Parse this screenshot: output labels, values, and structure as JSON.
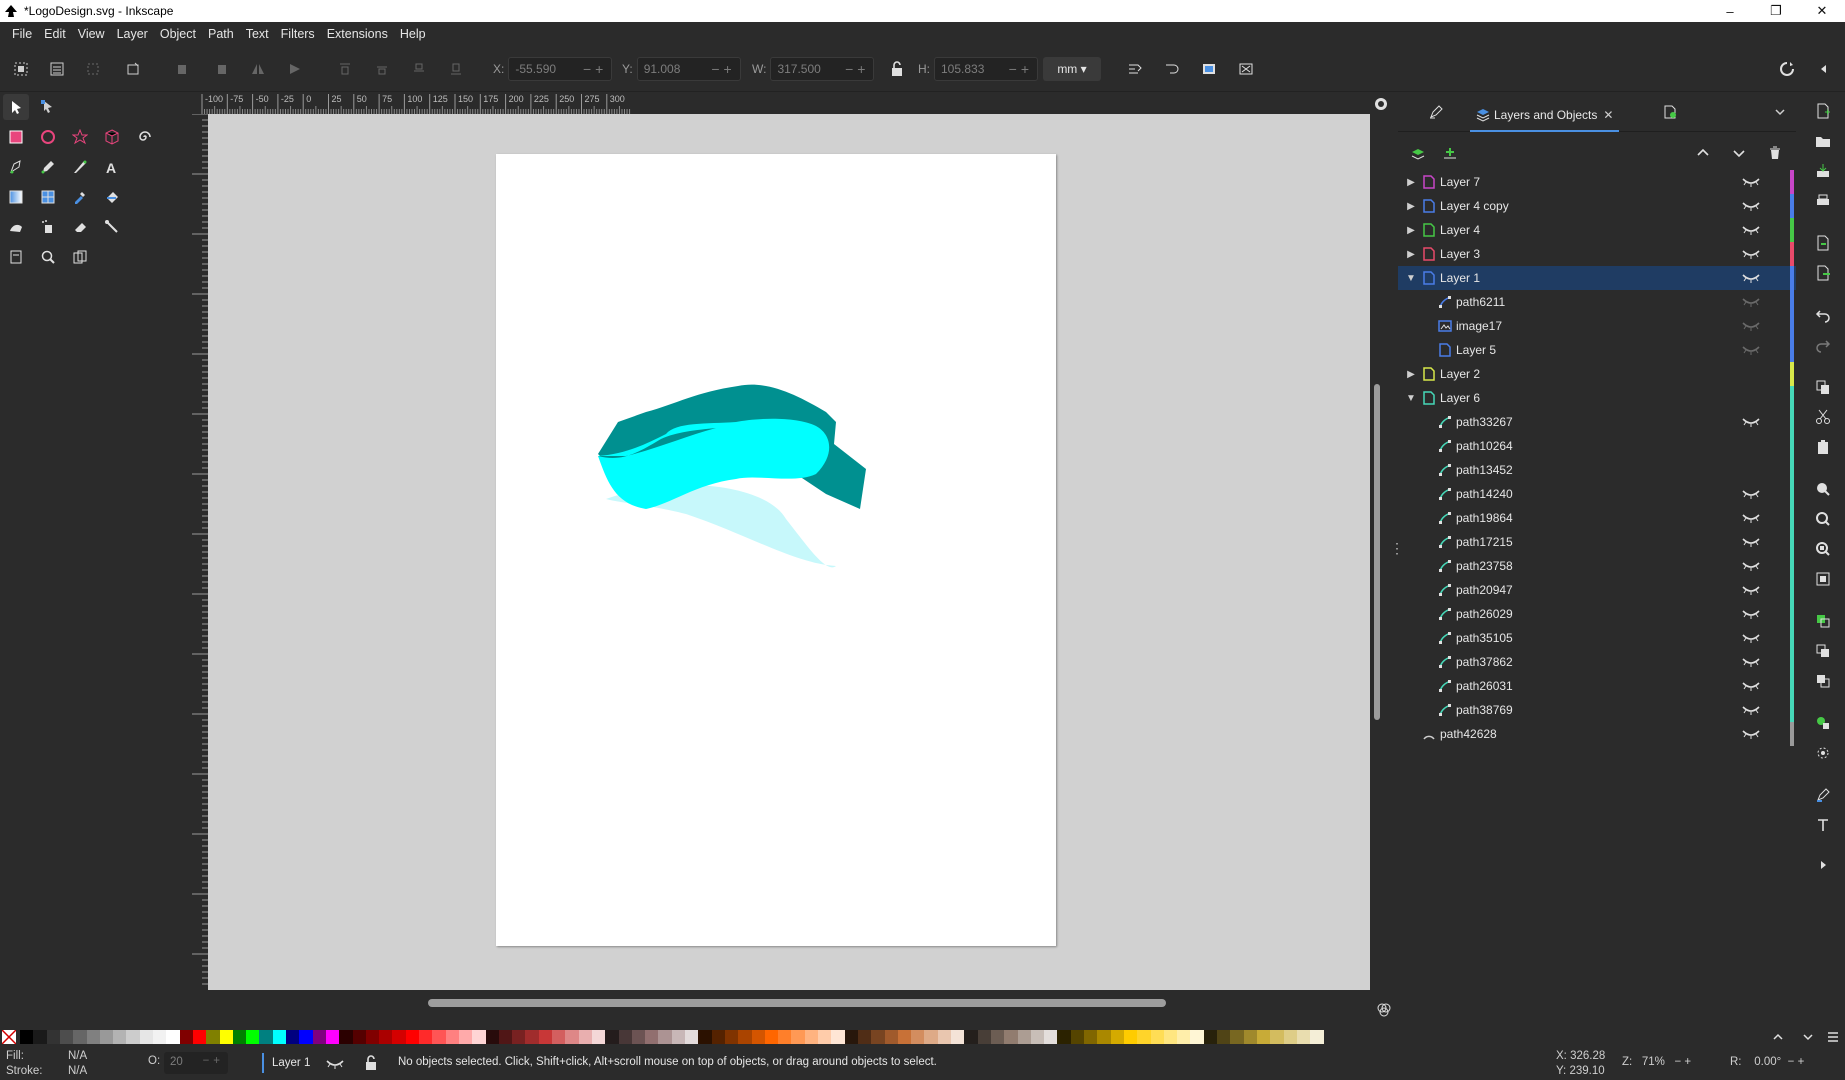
{
  "window": {
    "title": "*LogoDesign.svg - Inkscape",
    "controls": [
      "–",
      "❐",
      "✕"
    ]
  },
  "menu": [
    "File",
    "Edit",
    "View",
    "Layer",
    "Object",
    "Path",
    "Text",
    "Filters",
    "Extensions",
    "Help"
  ],
  "toolbar": {
    "x_label": "X:",
    "x_value": "-55.590",
    "y_label": "Y:",
    "y_value": "91.008",
    "w_label": "W:",
    "w_value": "317.500",
    "h_label": "H:",
    "h_value": "105.833",
    "unit": "mm"
  },
  "ruler_ticks": [
    "-100",
    "-75",
    "-50",
    "-25",
    "0",
    "25",
    "50",
    "75",
    "100",
    "125",
    "150",
    "175",
    "200",
    "225",
    "250",
    "275",
    "300"
  ],
  "dock": {
    "active_tab": "Layers and Objects",
    "layers": [
      {
        "label": "Layer 7",
        "kind": "layer",
        "level": 0,
        "expanded": false,
        "color": "#c846c8",
        "eye": "visible"
      },
      {
        "label": "Layer 4 copy",
        "kind": "layer",
        "level": 0,
        "expanded": false,
        "color": "#4a7de8",
        "eye": "visible"
      },
      {
        "label": "Layer 4",
        "kind": "layer",
        "level": 0,
        "expanded": false,
        "color": "#46c846",
        "eye": "visible"
      },
      {
        "label": "Layer 3",
        "kind": "layer",
        "level": 0,
        "expanded": false,
        "color": "#e84a6a",
        "eye": "visible"
      },
      {
        "label": "Layer 1",
        "kind": "layer",
        "level": 0,
        "expanded": true,
        "selected": true,
        "color": "#4a7de8",
        "eye": "visible"
      },
      {
        "label": "path6211",
        "kind": "path",
        "level": 1,
        "color": "#4a7de8",
        "eye": "faded"
      },
      {
        "label": "image17",
        "kind": "image",
        "level": 1,
        "color": "#4a7de8",
        "eye": "faded"
      },
      {
        "label": "Layer 5",
        "kind": "layer",
        "level": 1,
        "color": "#4a7de8",
        "eye": "faded"
      },
      {
        "label": "Layer 2",
        "kind": "layer",
        "level": 0,
        "expanded": false,
        "color": "#d8e84a",
        "eye": "none"
      },
      {
        "label": "Layer 6",
        "kind": "layer",
        "level": 0,
        "expanded": true,
        "color": "#46d8b8",
        "eye": "none"
      },
      {
        "label": "path33267",
        "kind": "path",
        "level": 1,
        "color": "#46d8b8",
        "eye": "visible"
      },
      {
        "label": "path10264",
        "kind": "path",
        "level": 1,
        "color": "#46d8b8",
        "eye": "none"
      },
      {
        "label": "path13452",
        "kind": "path",
        "level": 1,
        "color": "#46d8b8",
        "eye": "none"
      },
      {
        "label": "path14240",
        "kind": "path",
        "level": 1,
        "color": "#46d8b8",
        "eye": "visible"
      },
      {
        "label": "path19864",
        "kind": "path",
        "level": 1,
        "color": "#46d8b8",
        "eye": "visible"
      },
      {
        "label": "path17215",
        "kind": "path",
        "level": 1,
        "color": "#46d8b8",
        "eye": "visible"
      },
      {
        "label": "path23758",
        "kind": "path",
        "level": 1,
        "color": "#46d8b8",
        "eye": "visible"
      },
      {
        "label": "path20947",
        "kind": "path",
        "level": 1,
        "color": "#46d8b8",
        "eye": "visible"
      },
      {
        "label": "path26029",
        "kind": "path",
        "level": 1,
        "color": "#46d8b8",
        "eye": "visible"
      },
      {
        "label": "path35105",
        "kind": "path",
        "level": 1,
        "color": "#46d8b8",
        "eye": "visible"
      },
      {
        "label": "path37862",
        "kind": "path",
        "level": 1,
        "color": "#46d8b8",
        "eye": "visible"
      },
      {
        "label": "path26031",
        "kind": "path",
        "level": 1,
        "color": "#46d8b8",
        "eye": "visible"
      },
      {
        "label": "path38769",
        "kind": "path",
        "level": 1,
        "color": "#46d8b8",
        "eye": "visible"
      },
      {
        "label": "path42628",
        "kind": "arc",
        "level": 0,
        "color": "#9a9a9a",
        "eye": "visible"
      }
    ]
  },
  "status": {
    "fill_label": "Fill:",
    "fill_value": "N/A",
    "stroke_label": "Stroke:",
    "stroke_value": "N/A",
    "opacity_label": "O:",
    "opacity_value": "20",
    "layer": "Layer 1",
    "message": "No objects selected. Click, Shift+click, Alt+scroll mouse on top of objects, or drag around objects to select.",
    "x_label": "X:",
    "x_value": "326.28",
    "y_label": "Y:",
    "y_value": "239.10",
    "zoom_label": "Z:",
    "zoom_value": "71%",
    "rotation_label": "R:",
    "rotation_value": "0.00°"
  },
  "palette": [
    "#000000",
    "#1a1a1a",
    "#333333",
    "#4d4d4d",
    "#666666",
    "#808080",
    "#999999",
    "#b3b3b3",
    "#cccccc",
    "#e6e6e6",
    "#f2f2f2",
    "#ffffff",
    "#800000",
    "#ff0000",
    "#808000",
    "#ffff00",
    "#008000",
    "#00ff00",
    "#008080",
    "#00ffff",
    "#000080",
    "#0000ff",
    "#800080",
    "#ff00ff",
    "#2b0000",
    "#550000",
    "#800000",
    "#aa0000",
    "#d40000",
    "#ff0000",
    "#ff2a2a",
    "#ff5555",
    "#ff8080",
    "#ffaaaa",
    "#ffd5d5",
    "#280b0b",
    "#501616",
    "#782121",
    "#a02c2c",
    "#c83737",
    "#d35f5f",
    "#de8787",
    "#e9afaf",
    "#f4d7d7",
    "#241c1c",
    "#483737",
    "#6c5353",
    "#916f6f",
    "#ac9393",
    "#c8b7b7",
    "#e3dbdb",
    "#2b1100",
    "#552200",
    "#803300",
    "#aa4400",
    "#d45500",
    "#ff6600",
    "#ff7f2a",
    "#ff9955",
    "#ffb380",
    "#ffccaa",
    "#ffe6d5",
    "#28170b",
    "#502d16",
    "#784421",
    "#a05a2c",
    "#c87137",
    "#d38d5f",
    "#deaa87",
    "#e9c6af",
    "#f4e3d7",
    "#241f1c",
    "#483e37",
    "#6c5d53",
    "#917c6f",
    "#ac9d93",
    "#c8beb7",
    "#e3dedb",
    "#2b2200",
    "#554400",
    "#806600",
    "#aa8800",
    "#d4aa00",
    "#ffcc00",
    "#ffd42a",
    "#ffdd55",
    "#ffe680",
    "#ffeeaa",
    "#fff6d5",
    "#28220b",
    "#504416",
    "#786721",
    "#a0892c",
    "#c8ab37",
    "#d3bc5f",
    "#decd87",
    "#e9ddaf",
    "#f4eed7"
  ]
}
